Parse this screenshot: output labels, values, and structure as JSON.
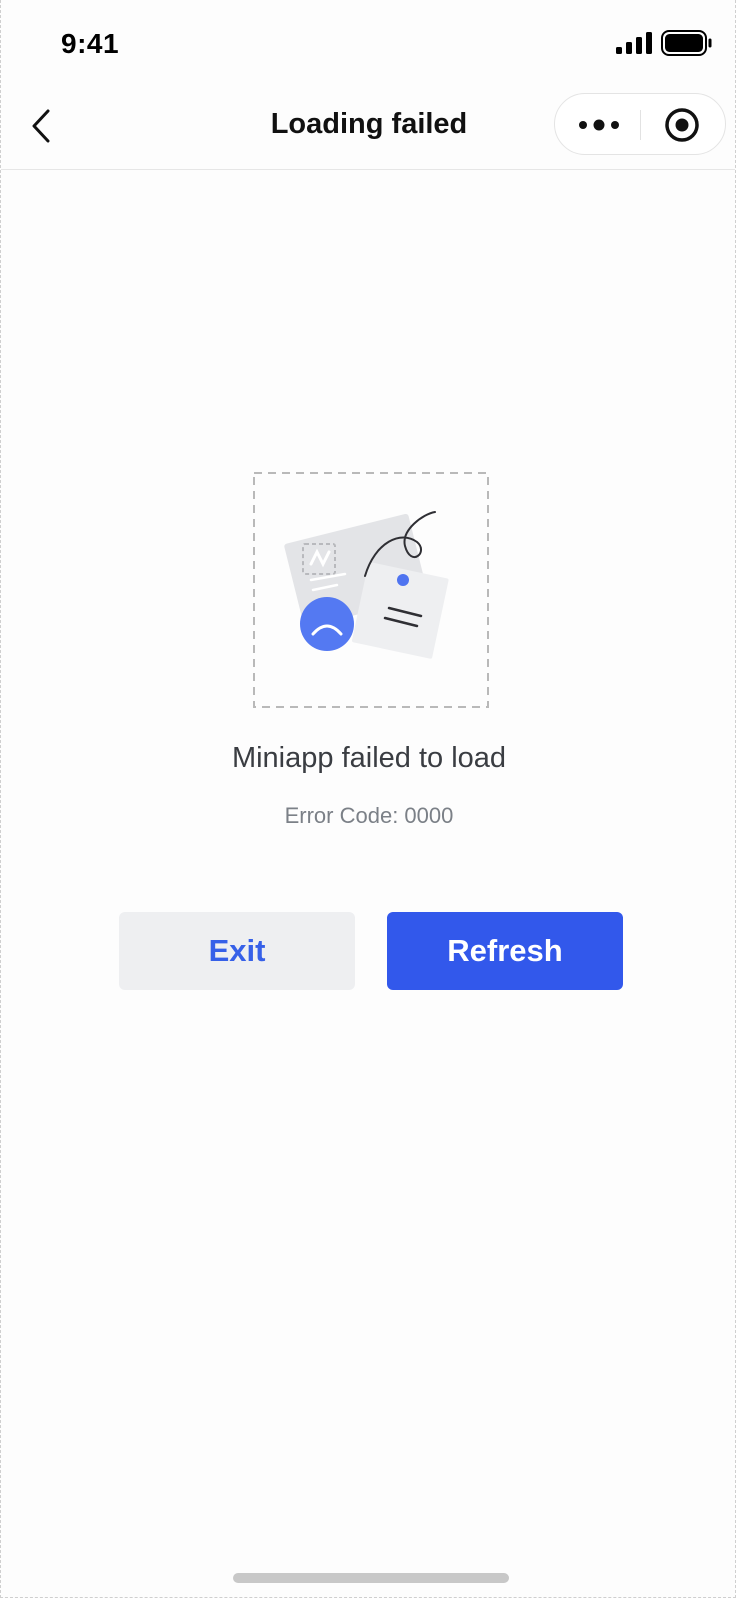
{
  "status_bar": {
    "time": "9:41"
  },
  "nav_bar": {
    "title": "Loading failed",
    "back_icon": "chevron-left-icon",
    "capsule_more_icon": "more-dots-icon",
    "capsule_close_icon": "target-circle-icon"
  },
  "content": {
    "title": "Miniapp failed to load",
    "error_code": "Error Code: 0000"
  },
  "buttons": {
    "exit_label": "Exit",
    "refresh_label": "Refresh"
  },
  "colors": {
    "primary": "#3258eb",
    "exit_bg": "#eeeff1",
    "exit_text": "#3660e8",
    "illustration_accent": "#4f74f0"
  }
}
